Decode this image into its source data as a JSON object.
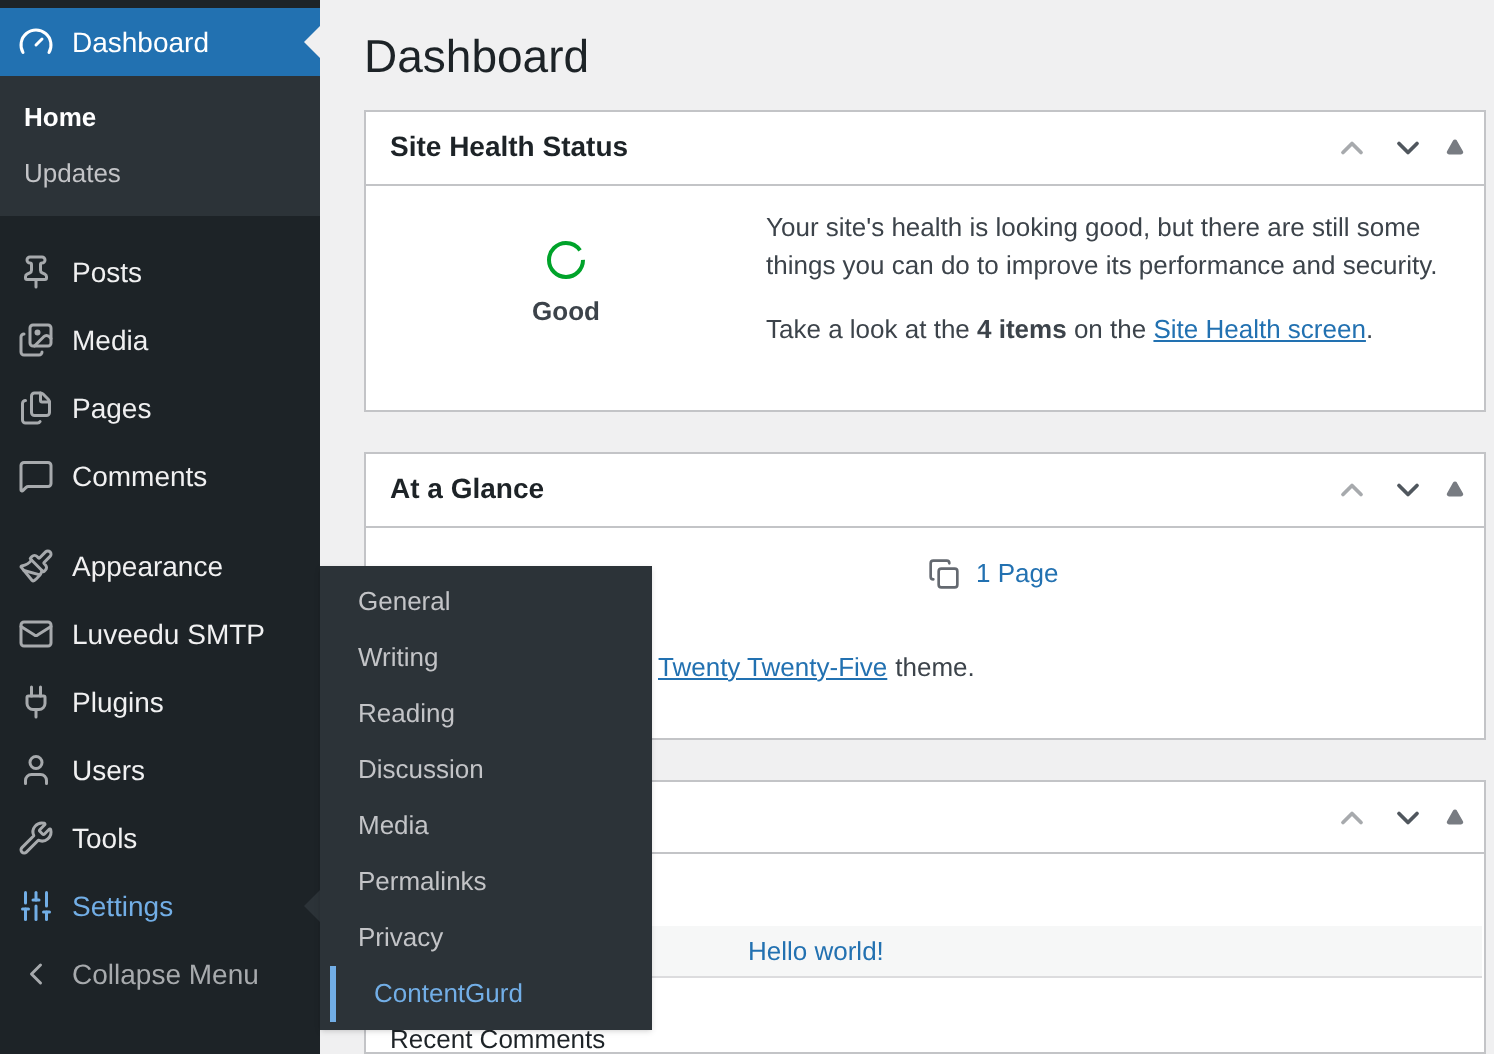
{
  "sidebar": {
    "groups": [
      {
        "items": [
          {
            "label": "Dashboard",
            "kind": "menu",
            "selected": true,
            "hover": false,
            "children": [
              {
                "label": "Home",
                "selected": true
              },
              {
                "label": "Updates",
                "selected": false
              }
            ]
          }
        ]
      },
      {
        "items": [
          {
            "label": "Posts",
            "kind": "menu",
            "selected": false,
            "hover": false
          },
          {
            "label": "Media",
            "kind": "menu",
            "selected": false,
            "hover": false
          },
          {
            "label": "Pages",
            "kind": "menu",
            "selected": false,
            "hover": false
          },
          {
            "label": "Comments",
            "kind": "menu",
            "selected": false,
            "hover": false
          }
        ]
      },
      {
        "items": [
          {
            "label": "Appearance",
            "kind": "menu",
            "selected": false,
            "hover": false
          },
          {
            "label": "Luveedu SMTP",
            "kind": "menu",
            "selected": false,
            "hover": false
          },
          {
            "label": "Plugins",
            "kind": "menu",
            "selected": false,
            "hover": false
          },
          {
            "label": "Users",
            "kind": "menu",
            "selected": false,
            "hover": false
          },
          {
            "label": "Tools",
            "kind": "menu",
            "selected": false,
            "hover": false
          },
          {
            "label": "Settings",
            "kind": "menu",
            "selected": false,
            "hover": true
          },
          {
            "label": "Collapse Menu",
            "kind": "collapse",
            "selected": false,
            "hover": false
          }
        ]
      }
    ]
  },
  "flyout": {
    "items": [
      {
        "label": "General",
        "selected": false
      },
      {
        "label": "Writing",
        "selected": false
      },
      {
        "label": "Reading",
        "selected": false
      },
      {
        "label": "Discussion",
        "selected": false
      },
      {
        "label": "Media",
        "selected": false
      },
      {
        "label": "Permalinks",
        "selected": false
      },
      {
        "label": "Privacy",
        "selected": false
      },
      {
        "label": "ContentGurd",
        "selected": true
      }
    ]
  },
  "page": {
    "title": "Dashboard",
    "site_health": {
      "title": "Site Health Status",
      "status": "Good",
      "message": "Your site's health is looking good, but there are still some things you can do to improve its performance and security.",
      "prompt_before": "Take a look at the **4 items** on the",
      "link": "Site Health screen",
      "prompt_after": "."
    },
    "at_a_glance": {
      "title": "At a Glance",
      "pages": "1 Page",
      "theme_link": "Twenty Twenty-Five",
      "theme_after": "theme."
    },
    "activity": {
      "post_link": "Hello world!",
      "section": "Recent Comments"
    }
  }
}
